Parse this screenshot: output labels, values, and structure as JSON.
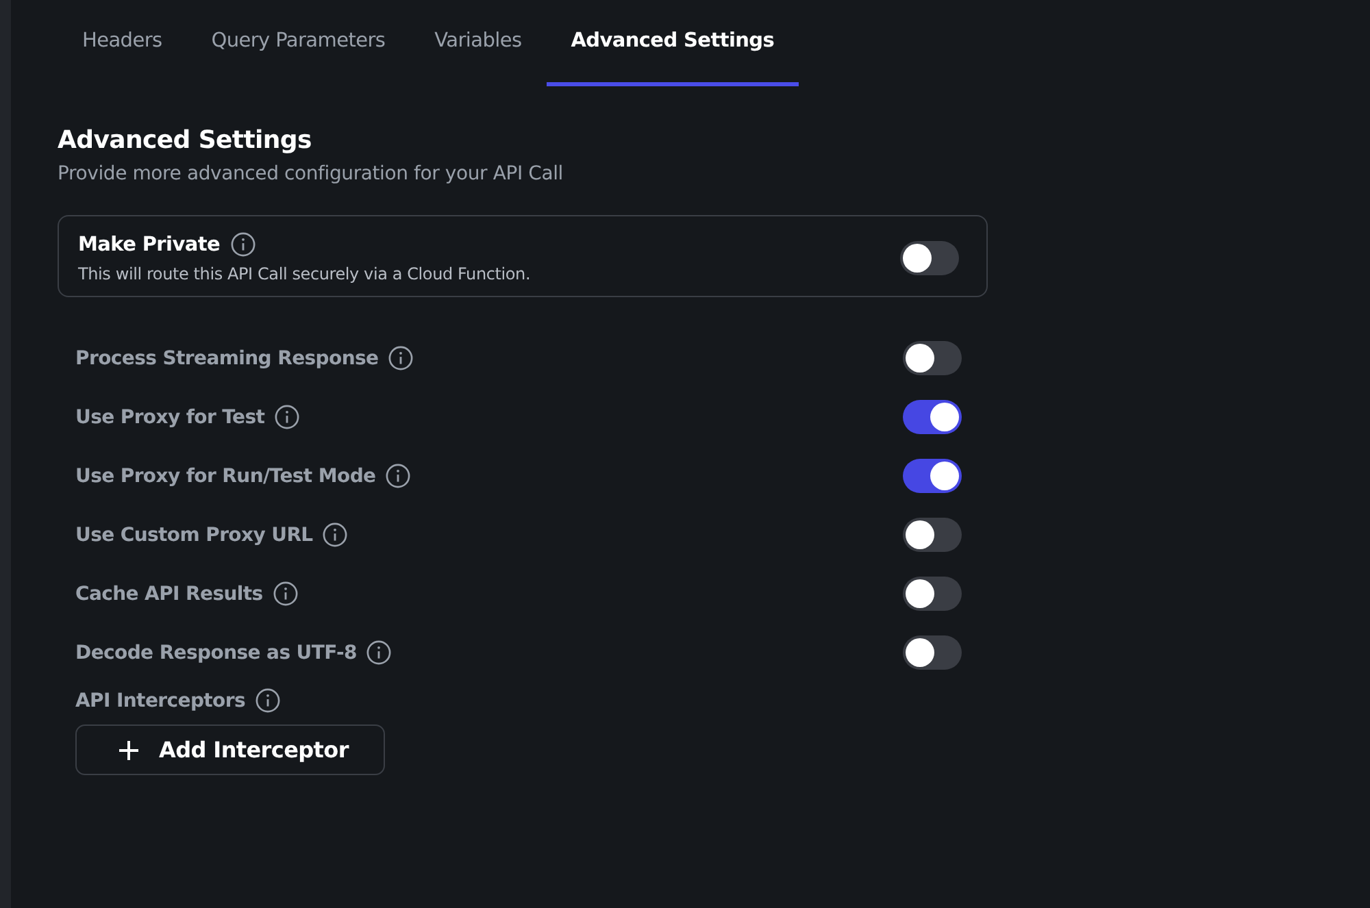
{
  "tabs": [
    {
      "label": "Headers",
      "selected": false
    },
    {
      "label": "Query Parameters",
      "selected": false
    },
    {
      "label": "Variables",
      "selected": false
    },
    {
      "label": "Advanced Settings",
      "selected": true
    }
  ],
  "section": {
    "title": "Advanced Settings",
    "subtitle": "Provide more advanced configuration for your API Call"
  },
  "private_card": {
    "label": "Make Private",
    "description": "This will route this API Call securely via a Cloud Function.",
    "on": false
  },
  "settings": [
    {
      "label": "Process Streaming Response",
      "on": false
    },
    {
      "label": "Use Proxy for Test",
      "on": true
    },
    {
      "label": "Use Proxy for Run/Test Mode",
      "on": true
    },
    {
      "label": "Use Custom Proxy URL",
      "on": false
    },
    {
      "label": "Cache API Results",
      "on": false
    },
    {
      "label": "Decode Response as UTF-8",
      "on": false
    }
  ],
  "interceptors": {
    "label": "API Interceptors",
    "button": "Add Interceptor"
  }
}
